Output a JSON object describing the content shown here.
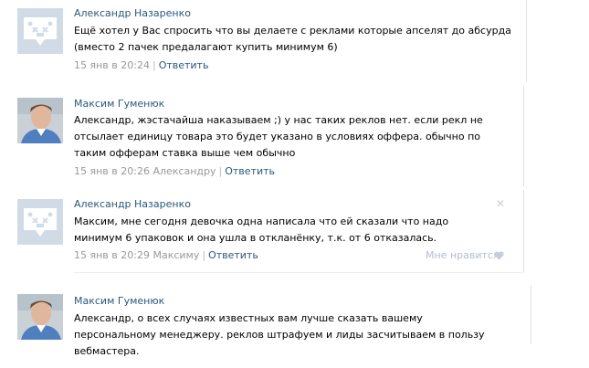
{
  "comments": [
    {
      "author": "Александр Назаренко",
      "avatar": "vk-camera-avatar-icon",
      "text": "Ещё хотел у Вас спросить что вы делаете с реклами которые апселят до абсурда (вместо 2 пачек предалагают купить минимум 6)",
      "date": "15 янв в 20:24",
      "reply_to": "",
      "reply_label": "Ответить"
    },
    {
      "author": "Максим Гуменюк",
      "avatar": "user-photo",
      "text": "Александр, жэстачайша наказываем ;) у нас таких реклов нет. если рекл не отсылает единицу товара это будет указано в условиях оффера. обычно по таким офферам ставка выше чем обычно",
      "date": "15 янв в 20:26",
      "reply_to": "Александру",
      "reply_label": "Ответить"
    },
    {
      "author": "Александр Назаренко",
      "avatar": "vk-camera-avatar-icon",
      "text": "Максим, мне сегодня девочка одна написала что ей сказали что надо минимум 6 упаковок и она ушла в откланёнку, т.к. от 6 отказалась.",
      "date": "15 янв в 20:29",
      "reply_to": "Максиму",
      "reply_label": "Ответить",
      "like_label": "Мне нравится",
      "close_glyph": "✕"
    },
    {
      "author": "Максим Гуменюк",
      "avatar": "user-photo",
      "text": "Александр, о всех случаях известных вам лучше сказать вашему персональному менеджеру. реклов штрафуем и лиды засчитываем в пользу вебмастера.",
      "date": "",
      "reply_to": "",
      "reply_label": ""
    }
  ],
  "colors": {
    "link": "#2b587a",
    "meta": "#999999",
    "avatar_bg": "#d1dbe6",
    "like": "#b5bec9"
  }
}
